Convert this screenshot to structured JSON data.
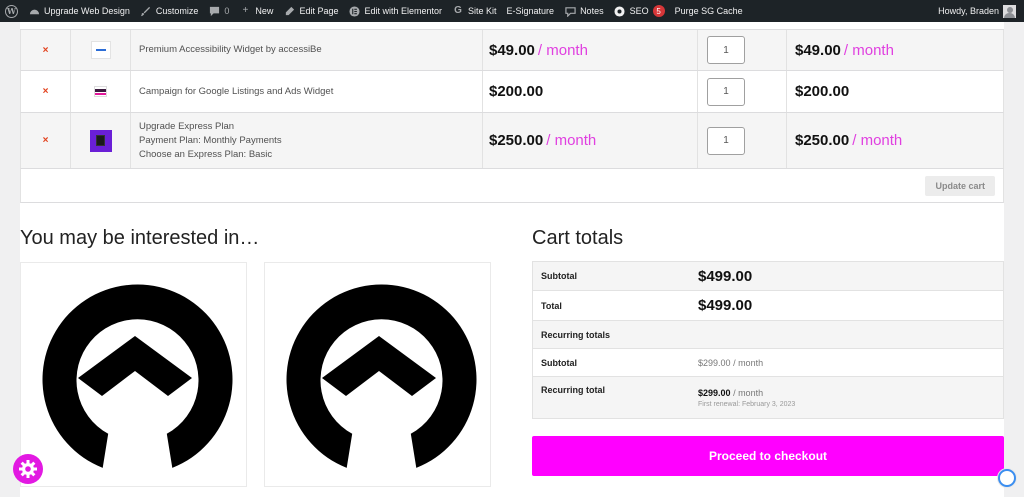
{
  "adminbar": {
    "site_name": "Upgrade Web Design",
    "customize": "Customize",
    "comments_count": "0",
    "new": "New",
    "edit_page": "Edit Page",
    "elementor": "Edit with Elementor",
    "site_kit": "Site Kit",
    "esignature": "E-Signature",
    "notes": "Notes",
    "seo": "SEO",
    "seo_badge": "5",
    "purge": "Purge SG Cache",
    "howdy": "Howdy, Braden"
  },
  "cart": {
    "remove_symbol": "×",
    "items": [
      {
        "name_lines": [
          "Premium Accessibility Widget by accessiBe"
        ],
        "price": "$49.00",
        "period": "/ month",
        "qty": "1",
        "subtotal": "$49.00",
        "sub_period": "/ month"
      },
      {
        "name_lines": [
          "Campaign for Google Listings and Ads Widget"
        ],
        "price": "$200.00",
        "period": "",
        "qty": "1",
        "subtotal": "$200.00",
        "sub_period": ""
      },
      {
        "name_lines": [
          "Upgrade Express Plan",
          "Payment Plan: Monthly Payments",
          "Choose an Express Plan: Basic"
        ],
        "price": "$250.00",
        "period": "/ month",
        "qty": "1",
        "subtotal": "$250.00",
        "sub_period": "/ month"
      }
    ],
    "update_label": "Update cart"
  },
  "interested": {
    "heading": "You may be interested in…"
  },
  "totals": {
    "heading": "Cart totals",
    "subtotal_label": "Subtotal",
    "subtotal_value": "$499.00",
    "total_label": "Total",
    "total_value": "$499.00",
    "recurring_heading": "Recurring totals",
    "rec_subtotal_label": "Subtotal",
    "rec_subtotal_value": "$299.00",
    "rec_subtotal_period": "/ month",
    "rec_total_label": "Recurring total",
    "rec_total_value": "$299.00",
    "rec_total_period": "/ month",
    "first_renewal": "First renewal: February 3, 2023",
    "checkout_label": "Proceed to checkout"
  },
  "colors": {
    "accent": "#ff00ff",
    "period_text": "#e040e0",
    "admin_bar": "#1d2327",
    "remove": "#e2401c"
  }
}
